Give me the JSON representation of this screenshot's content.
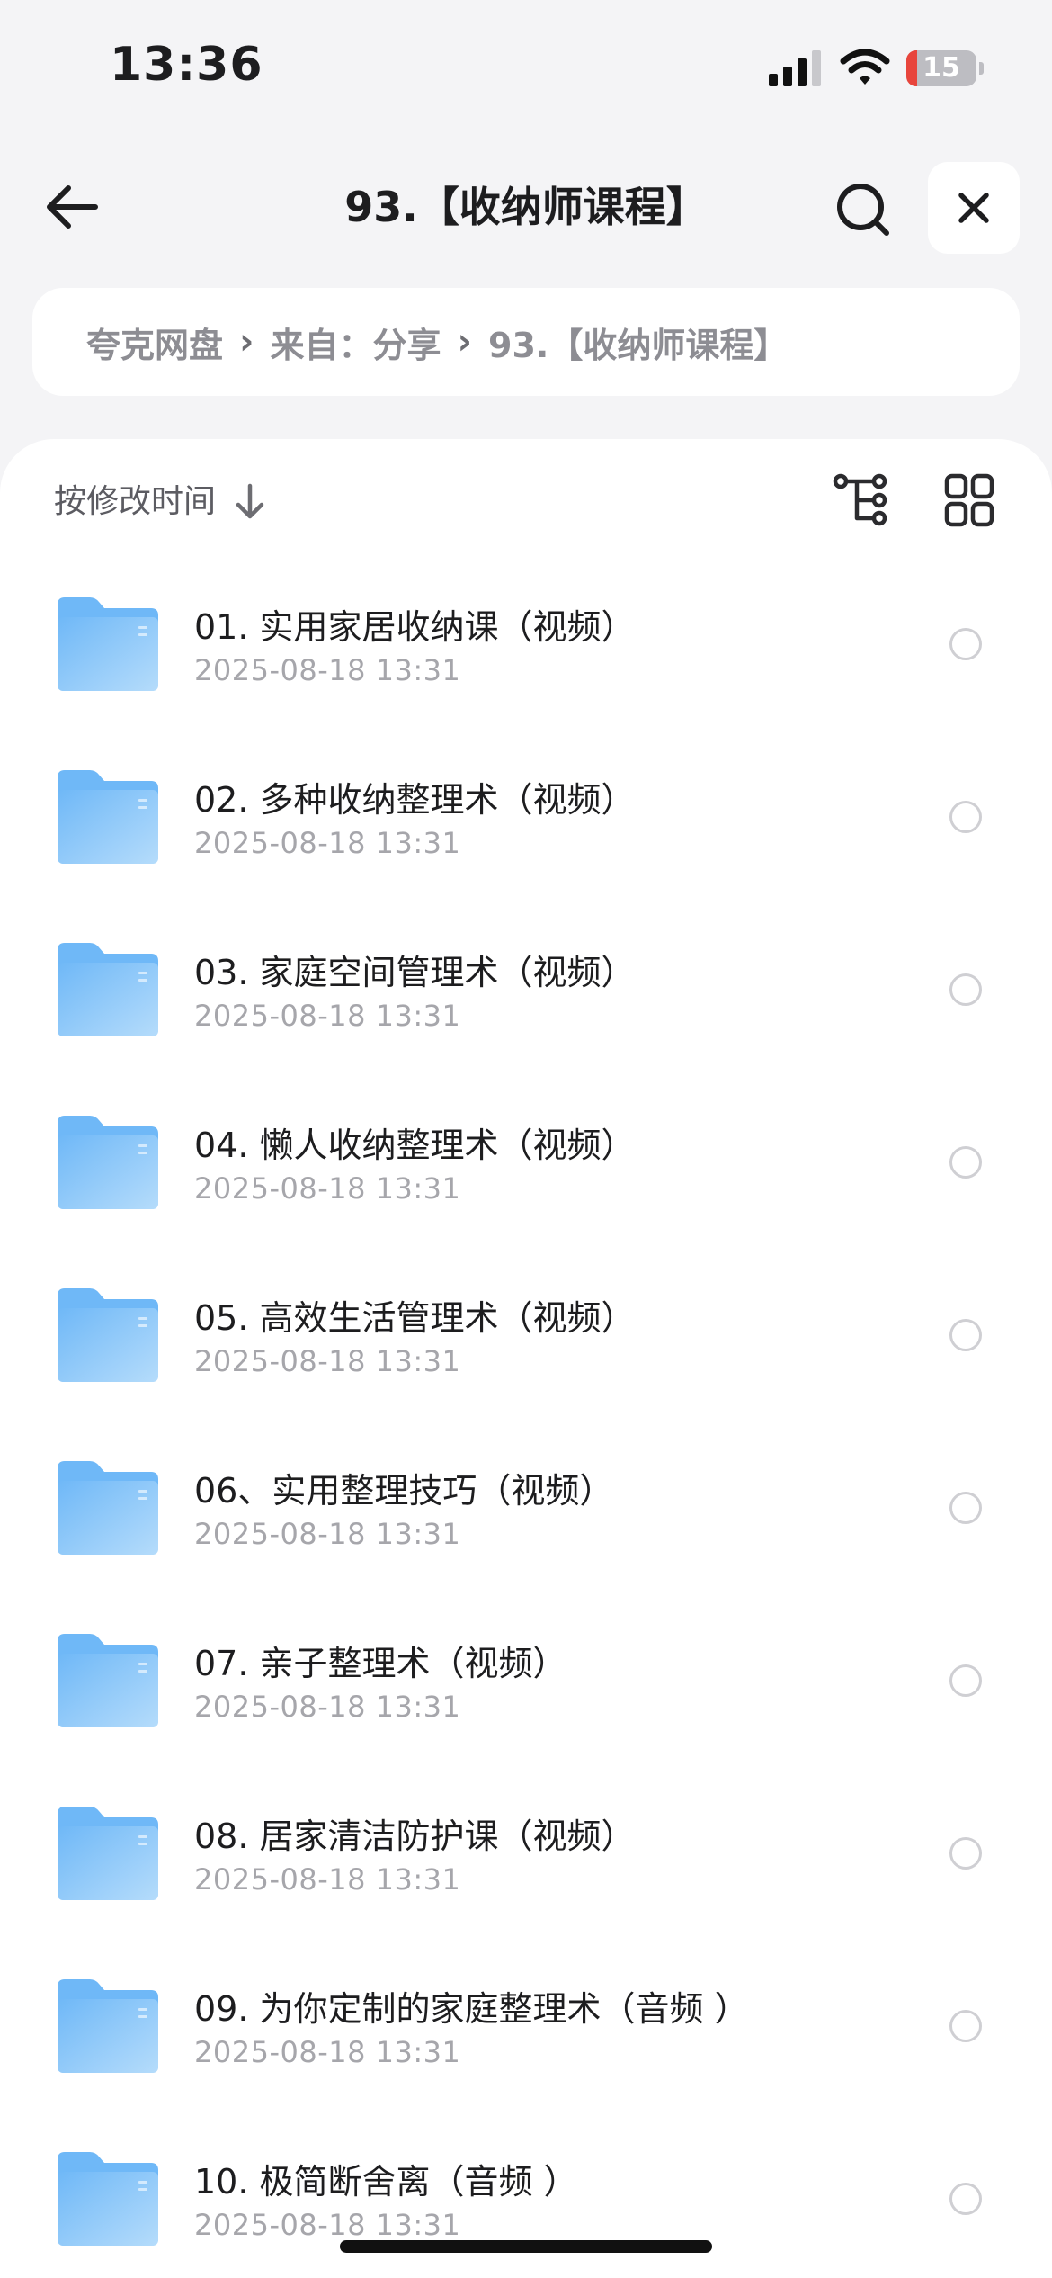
{
  "status_bar": {
    "time": "13:36",
    "battery_level": "15",
    "battery_fraction": 0.15,
    "battery_color": "#e8453c"
  },
  "nav": {
    "title": "93.【收纳师课程】",
    "back_icon": "arrow-left-icon",
    "search_icon": "search-icon",
    "close_icon": "close-icon"
  },
  "breadcrumb": {
    "items": [
      "夸克网盘",
      "来自：分享",
      "93.【收纳师课程】"
    ],
    "separator": "›"
  },
  "sort": {
    "label": "按修改时间",
    "direction_icon": "arrow-down-icon",
    "tree_icon": "tree-view-icon",
    "grid_icon": "grid-view-icon"
  },
  "files": [
    {
      "name": "01. 实用家居收纳课（视频）",
      "date": "2025-08-18 13:31"
    },
    {
      "name": "02. 多种收纳整理术（视频）",
      "date": "2025-08-18 13:31"
    },
    {
      "name": "03. 家庭空间管理术（视频）",
      "date": "2025-08-18 13:31"
    },
    {
      "name": "04. 懒人收纳整理术（视频）",
      "date": "2025-08-18 13:31"
    },
    {
      "name": "05. 高效生活管理术（视频）",
      "date": "2025-08-18 13:31"
    },
    {
      "name": "06、实用整理技巧（视频）",
      "date": "2025-08-18 13:31"
    },
    {
      "name": "07. 亲子整理术（视频）",
      "date": "2025-08-18 13:31"
    },
    {
      "name": "08. 居家清洁防护课（视频）",
      "date": "2025-08-18 13:31"
    },
    {
      "name": "09. 为你定制的家庭整理术（音频 ）",
      "date": "2025-08-18 13:31"
    },
    {
      "name": "10. 极简断舍离（音频 ）",
      "date": "2025-08-18 13:31"
    }
  ],
  "colors": {
    "folder_light": "#b5dcfb",
    "folder_dark": "#6fb8f7"
  }
}
